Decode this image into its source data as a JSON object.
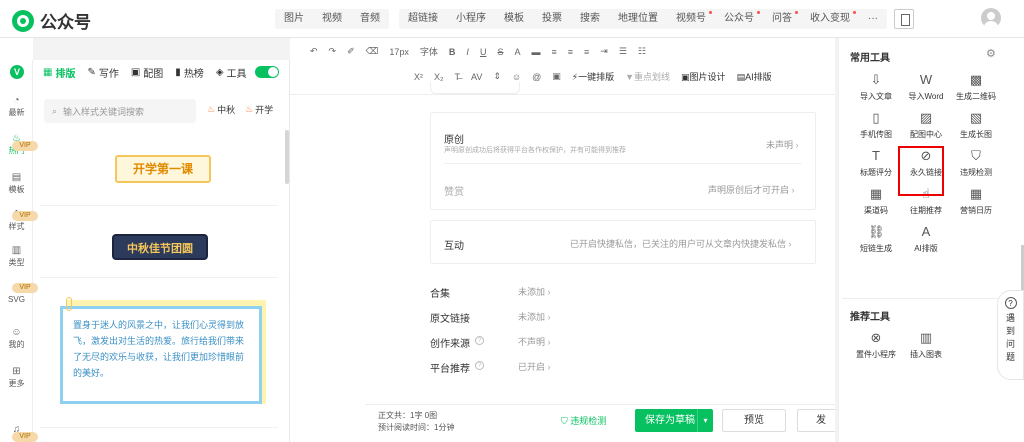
{
  "brand": {
    "name": "公众号"
  },
  "top_tabs_a": [
    "图片",
    "视频",
    "音频"
  ],
  "top_tabs_b": [
    {
      "label": "超链接",
      "dot": false
    },
    {
      "label": "小程序",
      "dot": false
    },
    {
      "label": "模板",
      "dot": false
    },
    {
      "label": "投票",
      "dot": false
    },
    {
      "label": "搜索",
      "dot": false
    },
    {
      "label": "地理位置",
      "dot": false
    },
    {
      "label": "视频号",
      "dot": true
    },
    {
      "label": "公众号",
      "dot": true
    },
    {
      "label": "问答",
      "dot": true
    },
    {
      "label": "收入变现",
      "dot": true
    },
    {
      "label": "···",
      "dot": false
    }
  ],
  "rail": [
    {
      "label": "最新",
      "icon": "clock-icon",
      "glyph": "◔",
      "active": false
    },
    {
      "label": "热门",
      "icon": "fire-icon",
      "glyph": "♨",
      "active": true
    },
    {
      "label": "模板",
      "icon": "template-icon",
      "glyph": "▤",
      "active": false
    },
    {
      "label": "样式",
      "icon": "style-icon",
      "glyph": "❖",
      "active": false
    },
    {
      "label": "类型",
      "icon": "type-icon",
      "glyph": "▥",
      "active": false
    },
    {
      "label": "SVG",
      "icon": "svg-icon",
      "glyph": "◇",
      "active": false
    },
    {
      "label": "我的",
      "icon": "user-icon",
      "glyph": "☺",
      "active": false
    },
    {
      "label": "更多",
      "icon": "more-icon",
      "glyph": "⊞",
      "active": false
    }
  ],
  "subtabs": [
    {
      "label": "排版",
      "icon": "layout-icon",
      "glyph": "▦",
      "active": true
    },
    {
      "label": "写作",
      "icon": "pen-icon",
      "glyph": "✎",
      "active": false
    },
    {
      "label": "配图",
      "icon": "image-icon",
      "glyph": "▣",
      "active": false
    },
    {
      "label": "热榜",
      "icon": "bookmark-icon",
      "glyph": "▮",
      "active": false
    },
    {
      "label": "工具",
      "icon": "cube-icon",
      "glyph": "◈",
      "active": false
    }
  ],
  "search": {
    "placeholder": "输入样式关键词搜索"
  },
  "hot_tags": [
    "中秋",
    "开学"
  ],
  "vip_label": "VIP",
  "cards": {
    "card1": "开学第一课",
    "card2": "中秋佳节团圆",
    "card3": "置身于迷人的风景之中，让我们心灵得到放飞，激发出对生活的热爱。旅行给我们带来了无尽的欢乐与收获，让我们更加珍惜眼前的美好。"
  },
  "toolbar": {
    "font_size": "17px",
    "font_face": "字体",
    "one_click_layout": "一键排版",
    "underline_style": "重点划线",
    "image_design": "图片设计",
    "ai_layout": "AI排版"
  },
  "editor": {
    "original": {
      "label": "原创",
      "desc": "声明原创成功后将获得平台各作权保护，并有可能得到推荐",
      "value": "未声明"
    },
    "reward": {
      "label": "赞赏",
      "value": "声明原创后才可开启"
    },
    "interact": {
      "label": "互动",
      "value": "已开启快捷私信，已关注的用户可从文章内快捷发私信"
    },
    "rows": [
      {
        "label": "合集",
        "value": "未添加",
        "help": false
      },
      {
        "label": "原文链接",
        "value": "未添加",
        "help": false
      },
      {
        "label": "创作来源",
        "value": "不声明",
        "help": true
      },
      {
        "label": "平台推荐",
        "value": "已开启",
        "help": true
      }
    ]
  },
  "footer": {
    "word_count_label": "正文共：",
    "word_count_value": "1字 0图",
    "read_time_label": "预计阅读时间：",
    "read_time_value": "1分钟",
    "check": "违规检测",
    "save": "保存为草稿",
    "preview": "预览",
    "publish": "发"
  },
  "tools": {
    "common_title": "常用工具",
    "common": [
      {
        "label": "导入文章",
        "icon": "import-icon",
        "glyph": "⇩"
      },
      {
        "label": "导入Word",
        "icon": "word-icon",
        "glyph": "W"
      },
      {
        "label": "生成二维码",
        "icon": "qrcode-icon",
        "glyph": "▩"
      },
      {
        "label": "手机传图",
        "icon": "phone-icon",
        "glyph": "▯"
      },
      {
        "label": "配图中心",
        "icon": "picture-icon",
        "glyph": "▨"
      },
      {
        "label": "生成长图",
        "icon": "long-image-icon",
        "glyph": "▧"
      },
      {
        "label": "标题评分",
        "icon": "title-icon",
        "glyph": "T"
      },
      {
        "label": "永久链接",
        "icon": "link-icon",
        "glyph": "⊘"
      },
      {
        "label": "违规检测",
        "icon": "shield-icon",
        "glyph": "⛉"
      },
      {
        "label": "渠道码",
        "icon": "channel-code-icon",
        "glyph": "▦"
      },
      {
        "label": "往期推荐",
        "icon": "thumb-icon",
        "glyph": "☝"
      },
      {
        "label": "营销日历",
        "icon": "calendar-icon",
        "glyph": "▦"
      },
      {
        "label": "短链生成",
        "icon": "short-link-icon",
        "glyph": "⛓"
      },
      {
        "label": "AI排版",
        "icon": "ai-layout-icon",
        "glyph": "A"
      }
    ],
    "recommend_title": "推荐工具",
    "recommend": [
      {
        "label": "置件小程序",
        "icon": "miniapp-icon",
        "glyph": "⊗"
      },
      {
        "label": "插入图表",
        "icon": "chart-icon",
        "glyph": "▥"
      }
    ]
  },
  "help": {
    "label": "遇到问题",
    "q": "?"
  }
}
